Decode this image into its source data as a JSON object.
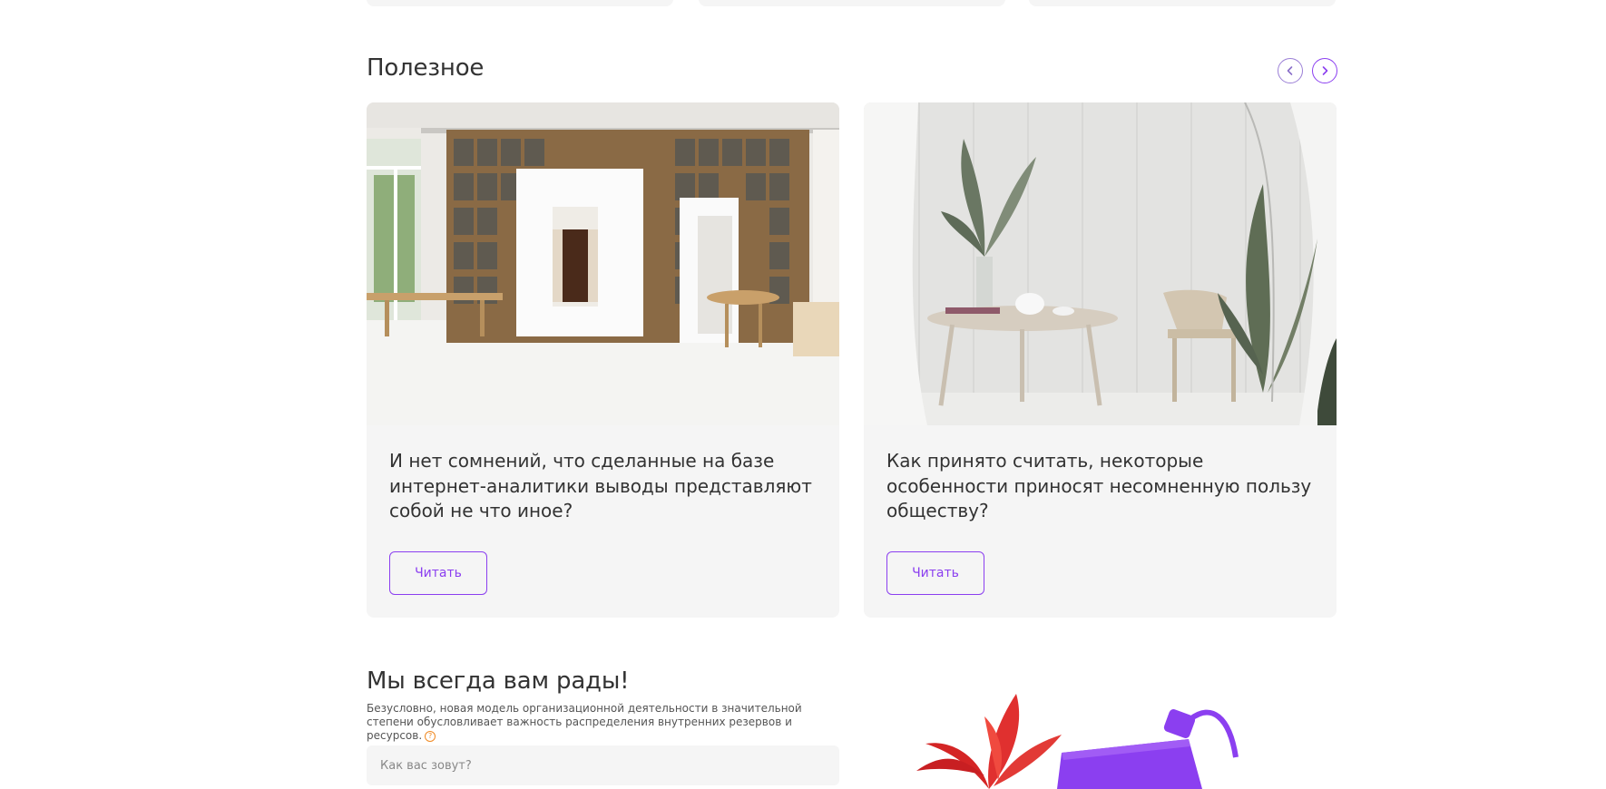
{
  "useful": {
    "title": "Полезное",
    "prev_icon": "chevron-left-icon",
    "next_icon": "chevron-right-icon",
    "cards": [
      {
        "image": "interior-bookshelves-photo",
        "title": "И нет сомнений, что сделанные на базе интернет-аналитики выводы представляют собой не что иное?",
        "button_label": "Читать"
      },
      {
        "image": "white-room-table-chair-photo",
        "title": "Как принято считать, некоторые особенности приносят несомненную пользу обществу?",
        "button_label": "Читать"
      }
    ]
  },
  "contact": {
    "title": "Мы всегда вам рады!",
    "subtitle": "Безусловно, новая модель организационной деятельности в значительной степени обусловливает важность распределения внутренних резервов и ресурсов.",
    "help_icon": "?",
    "name_placeholder": "Как вас зовут?"
  },
  "colors": {
    "accent": "#8b3ff0",
    "card_bg": "#f5f5f5",
    "help": "#f08a24"
  }
}
